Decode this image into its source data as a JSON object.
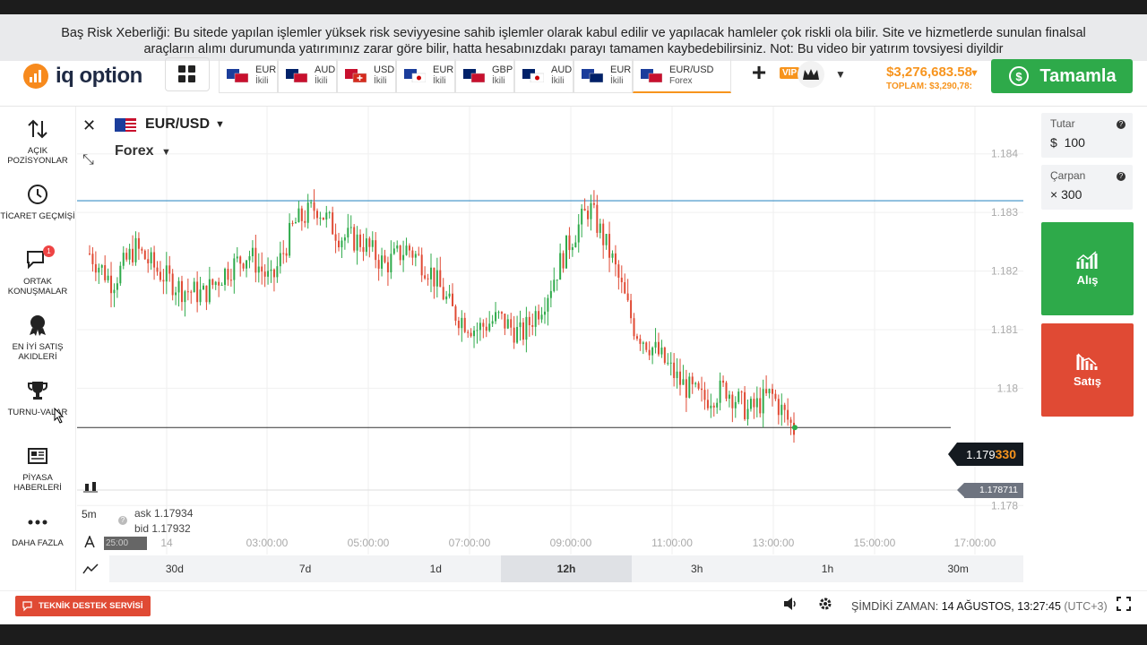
{
  "risk_warning": {
    "line1": "Baş Risk Xeberliği:  Bu sitede yapılan işlemler yüksek risk seviyyesine sahib işlemler olarak kabul edilir ve yapılacak hamleler çok riskli ola bilir. Site ve hizmetlerde sunulan finalsal",
    "line2": "araçların alımı durumunda yatırımınız zarar göre bilir, hatta hesabınızdakı parayı tamamen kaybedebilirsiniz. Not: Bu video bir yatırım tovsiyesi diyildir"
  },
  "header": {
    "logo_text": "iq option",
    "tabs": [
      {
        "name": "EUR",
        "type": "İkili",
        "flag": "eu-us"
      },
      {
        "name": "AUD",
        "type": "İkili",
        "flag": "au-us"
      },
      {
        "name": "USD",
        "type": "İkili",
        "flag": "us-ch"
      },
      {
        "name": "EUR",
        "type": "İkili",
        "flag": "eu-jp"
      },
      {
        "name": "GBP",
        "type": "İkili",
        "flag": "gb-us"
      },
      {
        "name": "AUD",
        "type": "İkili",
        "flag": "au-jp"
      },
      {
        "name": "EUR",
        "type": "İkili",
        "flag": "eu-au"
      },
      {
        "name": "EUR/USD",
        "type": "Forex",
        "flag": "eu-us",
        "active": true
      }
    ],
    "vip_label": "VIP",
    "balance": "$3,276,683.58",
    "total": "TOPLAM: $3,290,78:",
    "deposit_label": "Tamamla"
  },
  "sidebar": {
    "items": [
      {
        "label": "AÇIK POZİSYONLAR"
      },
      {
        "label": "TİCARET GEÇMİŞİ"
      },
      {
        "label": "ORTAK KONUŞMALAR",
        "badge": "1"
      },
      {
        "label": "EN İYİ SATIŞ AKIDLERİ"
      },
      {
        "label": "TURNU-VALAR"
      },
      {
        "label": "PİYASA HABERLERİ"
      },
      {
        "label": "DAHA FAZLA"
      }
    ]
  },
  "chart": {
    "pair": "EUR/USD",
    "instrument_type": "Forex",
    "current_price_prefix": "1.179",
    "current_price_suffix": "330",
    "secondary_price": "1.178711",
    "timeframe": "5m",
    "ask": "ask 1.17934",
    "bid": "bid 1.17932",
    "timer": "25:00",
    "periods": [
      "30d",
      "7d",
      "1d",
      "12h",
      "3h",
      "1h",
      "30m"
    ],
    "selected_period": "12h",
    "colors": {
      "up": "#2eaa4a",
      "down": "#e04a34",
      "resistance": "#3a8fc7"
    }
  },
  "chart_data": {
    "type": "candlestick",
    "y_ticks": [
      "1.184",
      "1.183",
      "1.182",
      "1.181",
      "1.18",
      "1.178"
    ],
    "x_ticks": [
      "14",
      "03:00:00",
      "05:00:00",
      "07:00:00",
      "09:00:00",
      "11:00:00",
      "13:00:00",
      "15:00:00",
      "17:00:00"
    ],
    "resistance_level": 1.1832,
    "current_price": 1.17933,
    "close_path": [
      1.1823,
      1.1818,
      1.1824,
      1.182,
      1.1817,
      1.1816,
      1.182,
      1.1823,
      1.1818,
      1.1828,
      1.1831,
      1.1826,
      1.1825,
      1.1821,
      1.1824,
      1.182,
      1.1813,
      1.181,
      1.1812,
      1.1809,
      1.1815,
      1.1824,
      1.1831,
      1.1822,
      1.181,
      1.1806,
      1.1801,
      1.1798,
      1.18,
      1.1796,
      1.1799,
      1.1793
    ]
  },
  "trade": {
    "amount_label": "Tutar",
    "amount_currency": "$",
    "amount_value": "100",
    "multiplier_label": "Çarpan",
    "multiplier_value": "× 300",
    "buy_label": "Alış",
    "sell_label": "Satış"
  },
  "footer": {
    "support_label": "TEKNİK DESTEK SERVİSİ",
    "now_label": "ŞİMDİKİ ZAMAN:",
    "now_value": "14 AĞUSTOS, 13:27:45",
    "tz": "(UTC+3)"
  }
}
